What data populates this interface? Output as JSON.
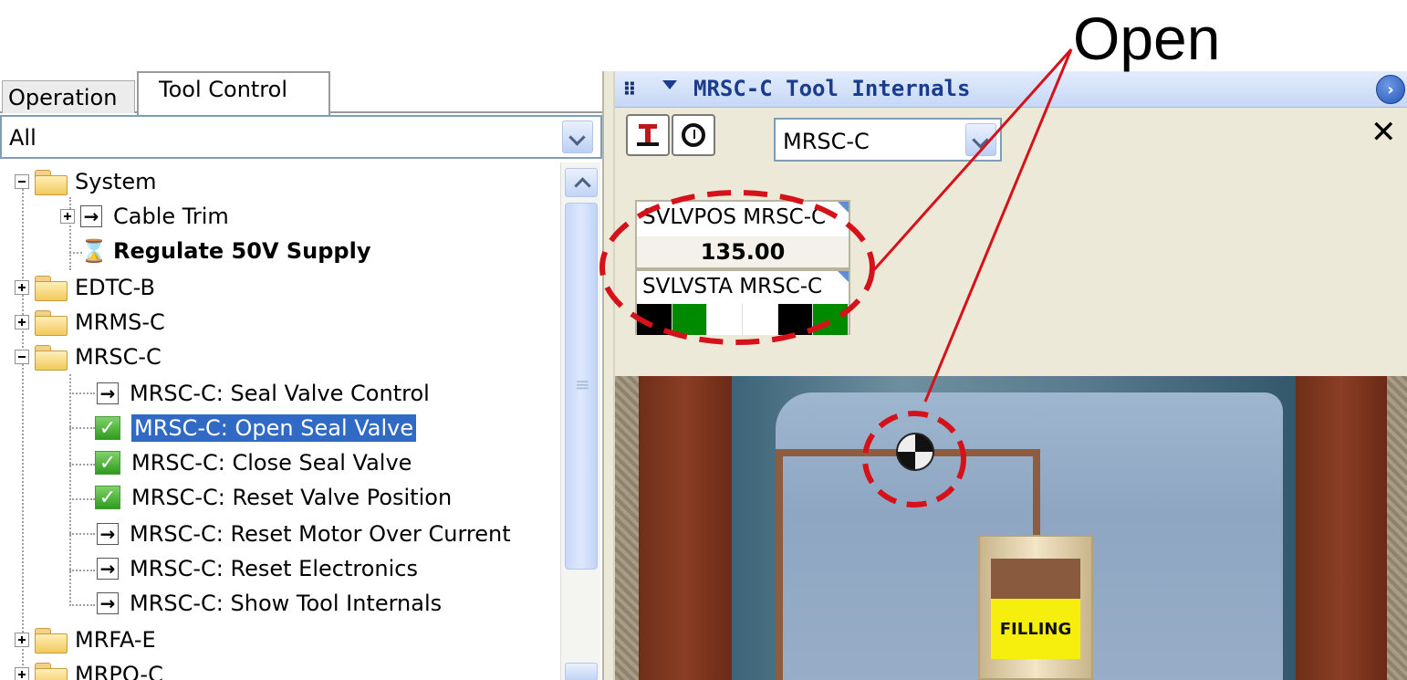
{
  "left_panel": {
    "tabs": [
      {
        "label": "Operation",
        "active": false
      },
      {
        "label": "Tool Control",
        "active": true
      }
    ],
    "filter": {
      "value": "All"
    },
    "tree": {
      "system": {
        "label": "System"
      },
      "cable_trim": {
        "label": "Cable Trim"
      },
      "regulate": {
        "label": "Regulate 50V Supply"
      },
      "edtc": {
        "label": "EDTC-B"
      },
      "mrms": {
        "label": "MRMS-C"
      },
      "mrsc": {
        "label": "MRSC-C"
      },
      "seal_valve_control": {
        "label": "MRSC-C: Seal Valve Control"
      },
      "open_seal_valve": {
        "label": "MRSC-C: Open Seal Valve"
      },
      "close_seal_valve": {
        "label": "MRSC-C: Close Seal Valve"
      },
      "reset_valve_position": {
        "label": "MRSC-C: Reset Valve Position"
      },
      "reset_motor": {
        "label": "MRSC-C: Reset Motor Over Current"
      },
      "reset_electronics": {
        "label": "MRSC-C: Reset Electronics"
      },
      "show_internals": {
        "label": "MRSC-C: Show Tool Internals"
      },
      "mrfa": {
        "label": "MRFA-E"
      },
      "mrpo": {
        "label": "MRPO-C"
      }
    }
  },
  "right_panel": {
    "title": "MRSC-C Tool Internals",
    "tool_select": {
      "value": "MRSC-C"
    },
    "readouts": {
      "position": {
        "label": "SVLVPOS MRSC-C",
        "value": "135.00"
      },
      "status": {
        "label": "SVLVSTA MRSC-C",
        "bits": [
          "#000000",
          "#008a00",
          "#ffffff",
          "#ffffff",
          "#000000",
          "#008a00"
        ]
      }
    },
    "simulation": {
      "piston_label": "FILLING"
    }
  },
  "annotation": {
    "label": "Open",
    "color": "#d5121a"
  },
  "colors": {
    "selection": "#316ac5",
    "header_text": "#1b3b8c"
  }
}
